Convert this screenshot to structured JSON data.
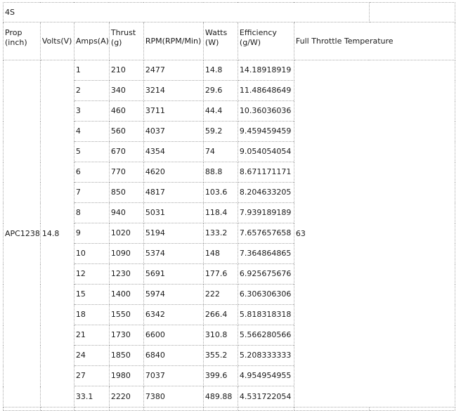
{
  "table": {
    "title": "4S",
    "headers": {
      "prop": "Prop\n(inch)",
      "volts": "Volts(V)",
      "amps": "Amps(A)",
      "thrust": "Thrust\n(g)",
      "rpm": "RPM(RPM/Min)",
      "watts": "Watts\n(W)",
      "efficiency": "Efficiency\n(g/W)",
      "temperature": "Full Throttle Temperature"
    },
    "prop": "APC1238",
    "volts": "14.8",
    "temperature": "63",
    "rows": [
      {
        "amps": "1",
        "thrust": "210",
        "rpm": "2477",
        "watts": "14.8",
        "efficiency": "14.18918919"
      },
      {
        "amps": "2",
        "thrust": "340",
        "rpm": "3214",
        "watts": "29.6",
        "efficiency": "11.48648649"
      },
      {
        "amps": "3",
        "thrust": "460",
        "rpm": "3711",
        "watts": "44.4",
        "efficiency": "10.36036036"
      },
      {
        "amps": "4",
        "thrust": "560",
        "rpm": "4037",
        "watts": "59.2",
        "efficiency": "9.459459459"
      },
      {
        "amps": "5",
        "thrust": "670",
        "rpm": "4354",
        "watts": "74",
        "efficiency": "9.054054054"
      },
      {
        "amps": "6",
        "thrust": "770",
        "rpm": "4620",
        "watts": "88.8",
        "efficiency": "8.671171171"
      },
      {
        "amps": "7",
        "thrust": "850",
        "rpm": "4817",
        "watts": "103.6",
        "efficiency": "8.204633205"
      },
      {
        "amps": "8",
        "thrust": "940",
        "rpm": "5031",
        "watts": "118.4",
        "efficiency": "7.939189189"
      },
      {
        "amps": "9",
        "thrust": "1020",
        "rpm": "5194",
        "watts": "133.2",
        "efficiency": "7.657657658"
      },
      {
        "amps": "10",
        "thrust": "1090",
        "rpm": "5374",
        "watts": "148",
        "efficiency": "7.364864865"
      },
      {
        "amps": "12",
        "thrust": "1230",
        "rpm": "5691",
        "watts": "177.6",
        "efficiency": "6.925675676"
      },
      {
        "amps": "15",
        "thrust": "1400",
        "rpm": "5974",
        "watts": "222",
        "efficiency": "6.306306306"
      },
      {
        "amps": "18",
        "thrust": "1550",
        "rpm": "6342",
        "watts": "266.4",
        "efficiency": "5.818318318"
      },
      {
        "amps": "21",
        "thrust": "1730",
        "rpm": "6600",
        "watts": "310.8",
        "efficiency": "5.566280566"
      },
      {
        "amps": "24",
        "thrust": "1850",
        "rpm": "6840",
        "watts": "355.2",
        "efficiency": "5.208333333"
      },
      {
        "amps": "27",
        "thrust": "1980",
        "rpm": "7037",
        "watts": "399.6",
        "efficiency": "4.954954955"
      },
      {
        "amps": "33.1",
        "thrust": "2220",
        "rpm": "7380",
        "watts": "489.88",
        "efficiency": "4.531722054"
      }
    ]
  }
}
